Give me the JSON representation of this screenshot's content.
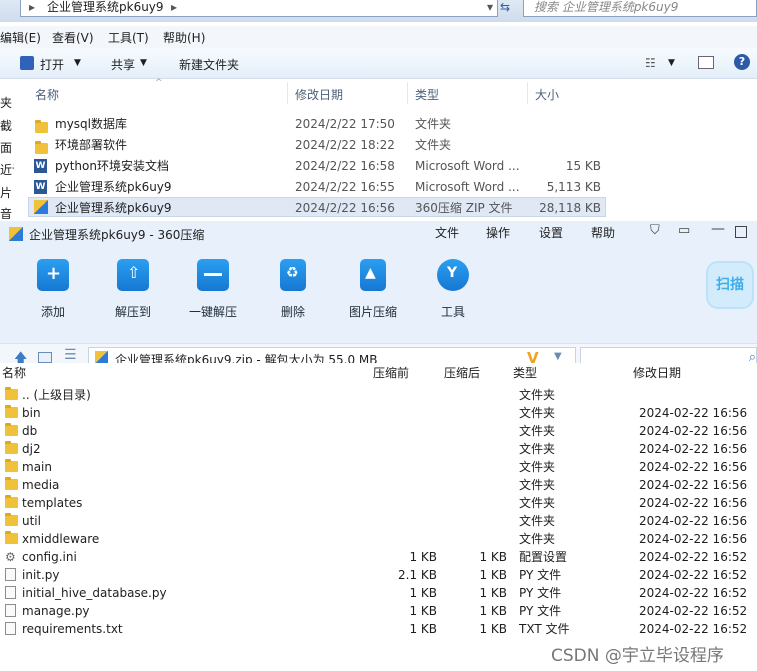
{
  "explorer": {
    "breadcrumb": "企业管理系统pk6uy9",
    "search_placeholder": "搜索 企业管理系统pk6uy9",
    "menu": [
      "编辑(E)",
      "查看(V)",
      "工具(T)",
      "帮助(H)"
    ],
    "commands": {
      "open": "打开",
      "share": "共享",
      "new_folder": "新建文件夹"
    },
    "columns": [
      "名称",
      "修改日期",
      "类型",
      "大小"
    ],
    "left_nav": [
      "夹",
      "截",
      "面",
      "近访",
      "片",
      "音"
    ],
    "rows": [
      {
        "name": "mysql数据库",
        "date": "2024/2/22 17:50",
        "type": "文件夹",
        "size": "",
        "icon": "folder"
      },
      {
        "name": "环境部署软件",
        "date": "2024/2/22 18:22",
        "type": "文件夹",
        "size": "",
        "icon": "folder"
      },
      {
        "name": "python环境安装文档",
        "date": "2024/2/22 16:58",
        "type": "Microsoft Word ...",
        "size": "15 KB",
        "icon": "word"
      },
      {
        "name": "企业管理系统pk6uy9",
        "date": "2024/2/22 16:55",
        "type": "Microsoft Word ...",
        "size": "5,113 KB",
        "icon": "word"
      },
      {
        "name": "企业管理系统pk6uy9",
        "date": "2024/2/22 16:56",
        "type": "360压缩 ZIP 文件",
        "size": "28,118 KB",
        "icon": "zip"
      }
    ]
  },
  "zip": {
    "title": "企业管理系统pk6uy9 - 360压缩",
    "menu": [
      "文件",
      "操作",
      "设置",
      "帮助"
    ],
    "tools": [
      "添加",
      "解压到",
      "一键解压",
      "删除",
      "图片压缩",
      "工具"
    ],
    "scan_label": "扫描",
    "path": "企业管理系统pk6uy9.zip - 解包大小为 55.0 MB",
    "columns": [
      "名称",
      "压缩前",
      "压缩后",
      "类型",
      "修改日期"
    ],
    "rows": [
      {
        "name": ".. (上级目录)",
        "before": "",
        "after": "",
        "type": "文件夹",
        "date": "",
        "icon": "folder"
      },
      {
        "name": "bin",
        "before": "",
        "after": "",
        "type": "文件夹",
        "date": "2024-02-22 16:56",
        "icon": "folder"
      },
      {
        "name": "db",
        "before": "",
        "after": "",
        "type": "文件夹",
        "date": "2024-02-22 16:56",
        "icon": "folder"
      },
      {
        "name": "dj2",
        "before": "",
        "after": "",
        "type": "文件夹",
        "date": "2024-02-22 16:56",
        "icon": "folder"
      },
      {
        "name": "main",
        "before": "",
        "after": "",
        "type": "文件夹",
        "date": "2024-02-22 16:56",
        "icon": "folder"
      },
      {
        "name": "media",
        "before": "",
        "after": "",
        "type": "文件夹",
        "date": "2024-02-22 16:56",
        "icon": "folder"
      },
      {
        "name": "templates",
        "before": "",
        "after": "",
        "type": "文件夹",
        "date": "2024-02-22 16:56",
        "icon": "folder"
      },
      {
        "name": "util",
        "before": "",
        "after": "",
        "type": "文件夹",
        "date": "2024-02-22 16:56",
        "icon": "folder"
      },
      {
        "name": "xmiddleware",
        "before": "",
        "after": "",
        "type": "文件夹",
        "date": "2024-02-22 16:56",
        "icon": "folder"
      },
      {
        "name": "config.ini",
        "before": "1 KB",
        "after": "1 KB",
        "type": "配置设置",
        "date": "2024-02-22 16:52",
        "icon": "gear"
      },
      {
        "name": "init.py",
        "before": "2.1 KB",
        "after": "1 KB",
        "type": "PY 文件",
        "date": "2024-02-22 16:52",
        "icon": "file"
      },
      {
        "name": "initial_hive_database.py",
        "before": "1 KB",
        "after": "1 KB",
        "type": "PY 文件",
        "date": "2024-02-22 16:52",
        "icon": "file"
      },
      {
        "name": "manage.py",
        "before": "1 KB",
        "after": "1 KB",
        "type": "PY 文件",
        "date": "2024-02-22 16:52",
        "icon": "file"
      },
      {
        "name": "requirements.txt",
        "before": "1 KB",
        "after": "1 KB",
        "type": "TXT 文件",
        "date": "2024-02-22 16:52",
        "icon": "file"
      }
    ]
  },
  "watermark": "CSDN @宇立毕设程序"
}
